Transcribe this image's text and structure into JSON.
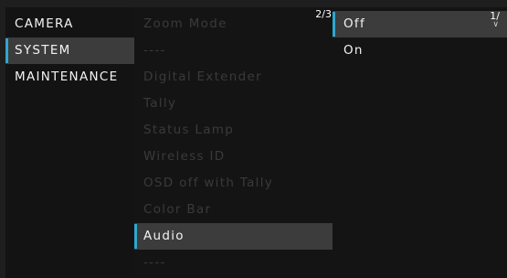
{
  "main_menu": {
    "items": [
      {
        "label": "CAMERA"
      },
      {
        "label": "SYSTEM"
      },
      {
        "label": "MAINTENANCE"
      }
    ],
    "selected_index": 1
  },
  "sub_menu": {
    "page_indicator": "2/3",
    "items": [
      {
        "label": "Zoom Mode"
      },
      {
        "label": "----"
      },
      {
        "label": "Digital Extender"
      },
      {
        "label": "Tally"
      },
      {
        "label": "Status Lamp"
      },
      {
        "label": "Wireless ID"
      },
      {
        "label": "OSD off with Tally"
      },
      {
        "label": "Color Bar"
      },
      {
        "label": "Audio"
      },
      {
        "label": "----"
      }
    ],
    "selected_index": 8
  },
  "option_menu": {
    "page_indicator": "1/",
    "scroll_icon": "chevron-down-icon",
    "items": [
      {
        "label": "Off"
      },
      {
        "label": "On"
      }
    ],
    "selected_index": 0
  },
  "colors": {
    "background": "#1e1e1e",
    "selected_background": "#3c3c3c",
    "selection_accent": "#2ea7cf",
    "dimmed_text": "#3a3a3a"
  }
}
